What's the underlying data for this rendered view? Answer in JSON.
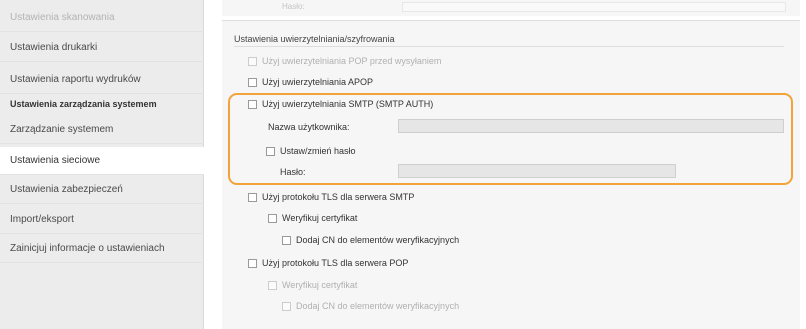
{
  "sidebar": {
    "items_top": [
      {
        "label": "Ustawienia skanowania",
        "state": "faded"
      },
      {
        "label": "Ustawienia drukarki",
        "state": "normal"
      },
      {
        "label": "Ustawienia raportu wydruków",
        "state": "normal"
      }
    ],
    "section_header": "Ustawienia zarządzania systemem",
    "items_bottom": [
      {
        "label": "Zarządzanie systemem",
        "state": "normal"
      },
      {
        "label": "Ustawienia sieciowe",
        "state": "active"
      },
      {
        "label": "Ustawienia zabezpieczeń",
        "state": "normal"
      },
      {
        "label": "Import/eksport",
        "state": "normal"
      },
      {
        "label": "Zainicjuj informacje o ustawieniach",
        "state": "normal"
      }
    ]
  },
  "main": {
    "top_faded_label": "Hasło:",
    "section_title": "Ustawienia uwierzytelniania/szyfrowania",
    "pop_before_smtp_label": "Użyj uwierzytelniania POP przed wysyłaniem",
    "apop_label": "Użyj uwierzytelniania APOP",
    "smtp_auth_label": "Użyj uwierzytelniania SMTP (SMTP AUTH)",
    "username_label": "Nazwa użytkownika:",
    "username_value": "",
    "set_password_label": "Ustaw/zmień hasło",
    "password_label": "Hasło:",
    "password_value": "",
    "tls_smtp_label": "Użyj protokołu TLS dla serwera SMTP",
    "smtp_verify_cert_label": "Weryfikuj certyfikat",
    "smtp_add_cn_label": "Dodaj CN do elementów weryfikacyjnych",
    "tls_pop_label": "Użyj protokołu TLS dla serwera POP",
    "pop_verify_cert_label": "Weryfikuj certyfikat",
    "pop_add_cn_label": "Dodaj CN do elementów weryfikacyjnych"
  },
  "colors": {
    "highlight": "#f2a33a",
    "sidebar_bg": "#ececec",
    "panel_bg": "#f6f6f6"
  }
}
